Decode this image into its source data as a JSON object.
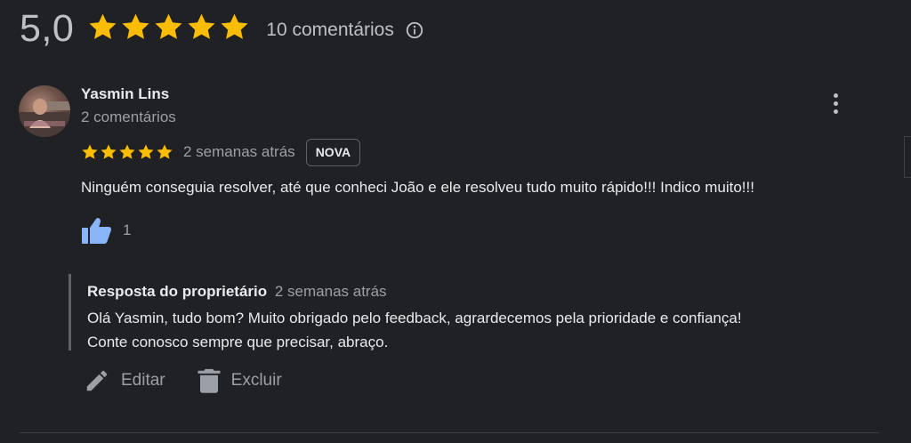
{
  "summary": {
    "rating_value": "5,0",
    "stars": 5,
    "review_count_label": "10 comentários",
    "info_icon": "info-icon"
  },
  "review": {
    "author_name": "Yasmin Lins",
    "author_meta": "2 comentários",
    "stars": 5,
    "time_ago": "2 semanas atrás",
    "badge": "NOVA",
    "text": "Ninguém conseguia resolver, até que conheci João e ele resolveu tudo muito rápido!!! Indico muito!!!",
    "like_count": "1",
    "more_icon": "more-vert-icon",
    "like_icon": "thumbs-up-icon"
  },
  "reply": {
    "label": "Resposta do proprietário",
    "time_ago": "2 semanas atrás",
    "line1": "Olá Yasmin, tudo bom? Muito obrigado pelo feedback, agrardecemos pela prioridade e confiança!",
    "line2": "Conte conosco sempre que precisar, abraço."
  },
  "actions": {
    "edit_label": "Editar",
    "delete_label": "Excluir",
    "edit_icon": "pencil-icon",
    "delete_icon": "trash-icon"
  },
  "colors": {
    "background": "#202124",
    "star": "#fbbc04",
    "like_blue": "#8ab4f8",
    "text_primary": "#e8eaed",
    "text_secondary": "#9aa0a6"
  }
}
